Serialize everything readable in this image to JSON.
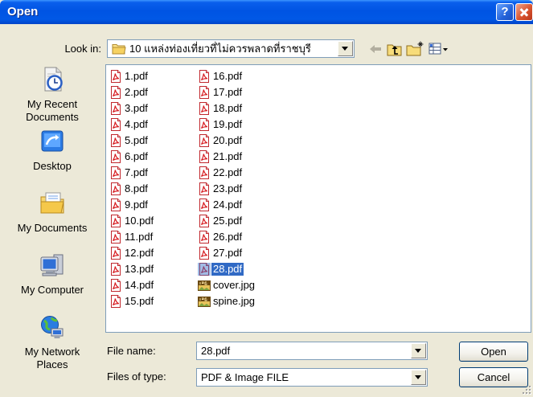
{
  "window": {
    "title": "Open",
    "help_label": "?",
    "close_icon": "close-icon"
  },
  "look_in": {
    "label": "Look in:",
    "value": "10 แหล่งท่องเที่ยวที่ไม่ควรพลาดที่ราชบุรี",
    "icon": "folder-icon"
  },
  "toolbar": [
    {
      "icon": "back-arrow-icon",
      "enabled": false
    },
    {
      "icon": "up-folder-icon",
      "enabled": true
    },
    {
      "icon": "new-folder-icon",
      "enabled": true
    },
    {
      "icon": "view-menu-icon",
      "enabled": true
    }
  ],
  "places": [
    {
      "label": "My Recent Documents",
      "icon": "recent-documents-icon"
    },
    {
      "label": "Desktop",
      "icon": "desktop-icon"
    },
    {
      "label": "My Documents",
      "icon": "my-documents-icon"
    },
    {
      "label": "My Computer",
      "icon": "my-computer-icon"
    },
    {
      "label": "My Network Places",
      "icon": "network-places-icon"
    }
  ],
  "files": [
    {
      "name": "1.pdf",
      "icon": "pdf-file-icon"
    },
    {
      "name": "2.pdf",
      "icon": "pdf-file-icon"
    },
    {
      "name": "3.pdf",
      "icon": "pdf-file-icon"
    },
    {
      "name": "4.pdf",
      "icon": "pdf-file-icon"
    },
    {
      "name": "5.pdf",
      "icon": "pdf-file-icon"
    },
    {
      "name": "6.pdf",
      "icon": "pdf-file-icon"
    },
    {
      "name": "7.pdf",
      "icon": "pdf-file-icon"
    },
    {
      "name": "8.pdf",
      "icon": "pdf-file-icon"
    },
    {
      "name": "9.pdf",
      "icon": "pdf-file-icon"
    },
    {
      "name": "10.pdf",
      "icon": "pdf-file-icon"
    },
    {
      "name": "11.pdf",
      "icon": "pdf-file-icon"
    },
    {
      "name": "12.pdf",
      "icon": "pdf-file-icon"
    },
    {
      "name": "13.pdf",
      "icon": "pdf-file-icon"
    },
    {
      "name": "14.pdf",
      "icon": "pdf-file-icon"
    },
    {
      "name": "15.pdf",
      "icon": "pdf-file-icon"
    },
    {
      "name": "16.pdf",
      "icon": "pdf-file-icon"
    },
    {
      "name": "17.pdf",
      "icon": "pdf-file-icon"
    },
    {
      "name": "18.pdf",
      "icon": "pdf-file-icon"
    },
    {
      "name": "19.pdf",
      "icon": "pdf-file-icon"
    },
    {
      "name": "20.pdf",
      "icon": "pdf-file-icon"
    },
    {
      "name": "21.pdf",
      "icon": "pdf-file-icon"
    },
    {
      "name": "22.pdf",
      "icon": "pdf-file-icon"
    },
    {
      "name": "23.pdf",
      "icon": "pdf-file-icon"
    },
    {
      "name": "24.pdf",
      "icon": "pdf-file-icon"
    },
    {
      "name": "25.pdf",
      "icon": "pdf-file-icon"
    },
    {
      "name": "26.pdf",
      "icon": "pdf-file-icon"
    },
    {
      "name": "27.pdf",
      "icon": "pdf-file-icon"
    },
    {
      "name": "28.pdf",
      "icon": "pdf-file-icon",
      "selected": true
    },
    {
      "name": "cover.jpg",
      "icon": "jpg-file-icon"
    },
    {
      "name": "spine.jpg",
      "icon": "jpg-file-icon"
    }
  ],
  "file_name": {
    "label": "File name:",
    "value": "28.pdf"
  },
  "file_type": {
    "label": "Files of type:",
    "value": "PDF & Image FILE"
  },
  "buttons": {
    "open": "Open",
    "cancel": "Cancel"
  },
  "colors": {
    "title_bar": "#0054E3",
    "dialog_background": "#ECE9D8",
    "selection": "#316AC5",
    "list_background": "#FFFFFF",
    "close_button": "#D9542F"
  }
}
